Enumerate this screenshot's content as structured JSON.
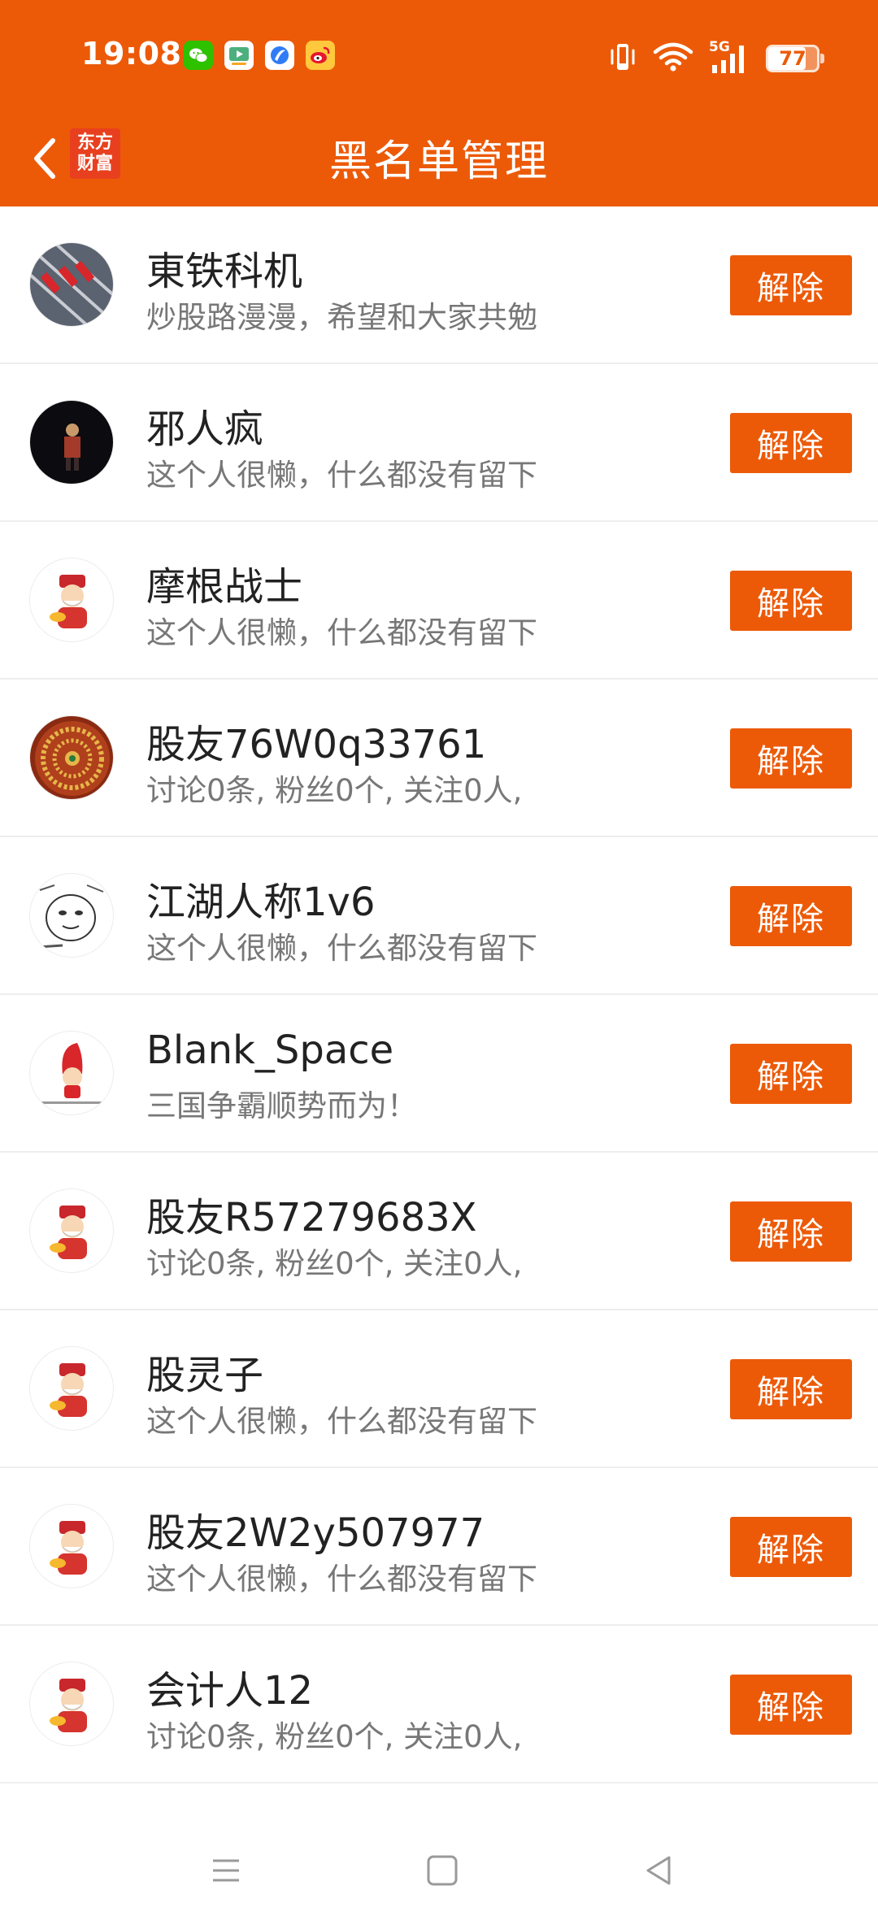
{
  "status_bar": {
    "time": "19:08",
    "notifications": [
      "wechat-icon",
      "video-app-icon",
      "browser-app-icon",
      "weibo-icon"
    ],
    "network_label": "5G",
    "battery_level": 77,
    "battery_text": "77"
  },
  "header": {
    "title": "黑名单管理",
    "brand_line1": "东方",
    "brand_line2": "财富"
  },
  "colors": {
    "accent": "#EC5A08",
    "text_primary": "#222222",
    "text_secondary": "#777777"
  },
  "blacklist": [
    {
      "name": "東铁科机",
      "bio": "炒股路漫漫，希望和大家共勉",
      "button": "解除",
      "avatar": "rails-photo-avatar"
    },
    {
      "name": "邪人疯",
      "bio": "这个人很懒，什么都没有留下",
      "button": "解除",
      "avatar": "performer-photo-avatar"
    },
    {
      "name": "摩根战士",
      "bio": "这个人很懒，什么都没有留下",
      "button": "解除",
      "avatar": "fortune-god-avatar"
    },
    {
      "name": "股友76W0q33761",
      "bio": "讨论0条, 粉丝0个, 关注0人,",
      "button": "解除",
      "avatar": "ornament-avatar"
    },
    {
      "name": "江湖人称1v6",
      "bio": "这个人很懒，什么都没有留下",
      "button": "解除",
      "avatar": "sketch-meme-avatar"
    },
    {
      "name": "Blank_Space",
      "bio": "三国争霸顺势而为！",
      "button": "解除",
      "avatar": "red-hat-cartoon-avatar"
    },
    {
      "name": "股友R57279683X",
      "bio": "讨论0条, 粉丝0个, 关注0人,",
      "button": "解除",
      "avatar": "fortune-god-avatar"
    },
    {
      "name": "股灵子",
      "bio": "这个人很懒，什么都没有留下",
      "button": "解除",
      "avatar": "fortune-god-avatar"
    },
    {
      "name": "股友2W2y507977",
      "bio": "这个人很懒，什么都没有留下",
      "button": "解除",
      "avatar": "fortune-god-avatar"
    },
    {
      "name": "会计人12",
      "bio": "讨论0条, 粉丝0个, 关注0人,",
      "button": "解除",
      "avatar": "fortune-god-avatar"
    }
  ],
  "system_nav": [
    "menu-icon",
    "home-icon",
    "back-triangle-icon"
  ]
}
